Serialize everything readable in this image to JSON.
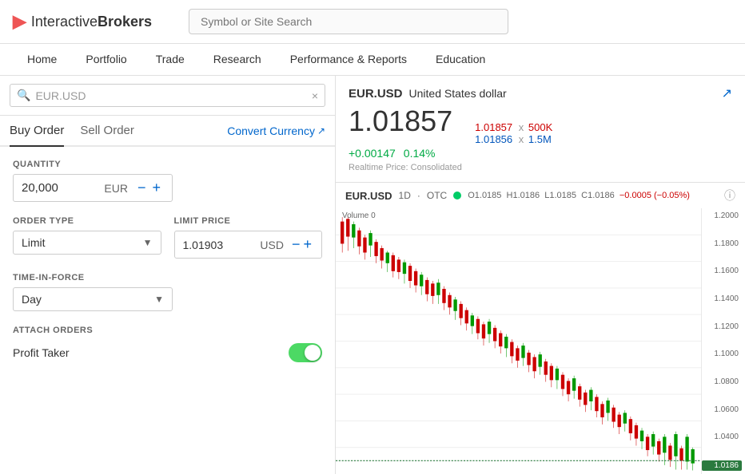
{
  "logo": {
    "icon": "●",
    "interactive": "Interactive",
    "brokers": "Brokers"
  },
  "search": {
    "placeholder": "Symbol or Site Search"
  },
  "nav": {
    "items": [
      {
        "label": "Home",
        "active": false
      },
      {
        "label": "Portfolio",
        "active": false
      },
      {
        "label": "Trade",
        "active": false
      },
      {
        "label": "Research",
        "active": false
      },
      {
        "label": "Performance & Reports",
        "active": false
      },
      {
        "label": "Education",
        "active": false
      }
    ]
  },
  "symbolSearch": {
    "value": "EUR.USD",
    "clearLabel": "×"
  },
  "orderTabs": {
    "buy": "Buy Order",
    "sell": "Sell Order",
    "convert": "Convert Currency"
  },
  "quantity": {
    "label": "QUANTITY",
    "value": "20,000",
    "currency": "EUR",
    "minus": "−",
    "plus": "+"
  },
  "orderType": {
    "label": "ORDER TYPE",
    "value": "Limit",
    "arrow": "▼"
  },
  "limitPrice": {
    "label": "LIMIT PRICE",
    "value": "1.01903",
    "currency": "USD",
    "minus": "−",
    "plus": "+"
  },
  "timeInForce": {
    "label": "TIME-IN-FORCE",
    "value": "Day",
    "arrow": "▼"
  },
  "attachOrders": {
    "label": "ATTACH ORDERS"
  },
  "profitTaker": {
    "label": "Profit Taker"
  },
  "symbol": {
    "ticker": "EUR.USD",
    "name": "United States dollar",
    "price": "1.01857",
    "changeAbs": "+0.00147",
    "changePct": "0.14%",
    "bidPrice": "1.01857",
    "bidSize": "500K",
    "askPrice": "1.01856",
    "askSize": "1.5M",
    "realtimeLabel": "Realtime Price: Consolidated",
    "expandIcon": "↗"
  },
  "chart": {
    "symbol": "EUR.USD",
    "interval": "1D",
    "exchange": "OTC",
    "dotColor": "#00cc66",
    "open": "1.0185",
    "high": "1.0186",
    "low": "1.0185",
    "close": "1.0186",
    "changeVal": "−0.0005",
    "changePct": "(−0.05%)",
    "volumeLabel": "Volume",
    "volumeVal": "0",
    "yLabels": [
      "1.2000",
      "1.1800",
      "1.1600",
      "1.1400",
      "1.1200",
      "1.1000",
      "1.0800",
      "1.0600",
      "1.0400",
      ""
    ],
    "currentPrice": "1.0186"
  }
}
